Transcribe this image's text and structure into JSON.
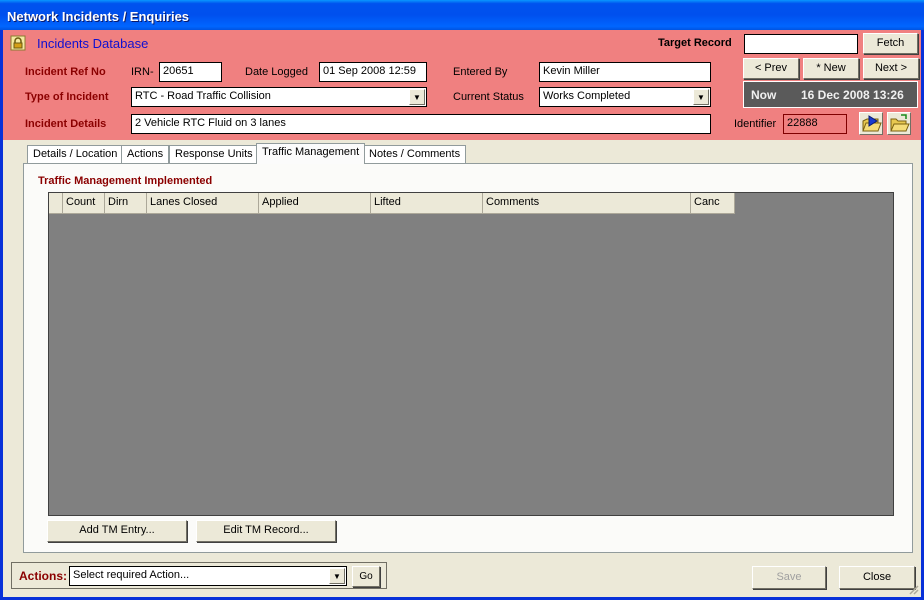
{
  "window": {
    "title": "Network Incidents / Enquiries"
  },
  "header": {
    "db_title": "Incidents Database",
    "target_record_label": "Target Record",
    "target_record_value": "",
    "fetch_label": "Fetch",
    "prev_label": "< Prev",
    "new_label": "* New",
    "next_label": "Next >",
    "now_label": "Now",
    "now_value": "16 Dec 2008 13:26",
    "incident_ref_label": "Incident Ref No",
    "irn_prefix": "IRN-",
    "irn_value": "20651",
    "date_logged_label": "Date Logged",
    "date_logged_value": "01 Sep 2008 12:59",
    "entered_by_label": "Entered By",
    "entered_by_value": "Kevin Miller",
    "type_label": "Type of Incident",
    "type_value": "RTC - Road Traffic Collision",
    "status_label": "Current Status",
    "status_value": "Works Completed",
    "details_label": "Incident Details",
    "details_value": "2 Vehicle RTC Fluid on 3 lanes",
    "identifier_label": "Identifier",
    "identifier_value": "22888",
    "accent_color": "#f08080"
  },
  "tabs": [
    {
      "label": "Details / Location"
    },
    {
      "label": "Actions"
    },
    {
      "label": "Response Units"
    },
    {
      "label": "Traffic Management"
    },
    {
      "label": "Notes / Comments"
    }
  ],
  "active_tab": "Traffic Management",
  "panel": {
    "section_title": "Traffic Management Implemented",
    "columns": [
      "",
      "Count",
      "Dirn",
      "Lanes Closed",
      "Applied",
      "Lifted",
      "Comments",
      "Canc"
    ],
    "rows": [],
    "add_button": "Add TM Entry...",
    "edit_button": "Edit TM Record..."
  },
  "footer": {
    "actions_label": "Actions:",
    "actions_value": "Select required Action...",
    "go_label": "Go",
    "save_label": "Save",
    "close_label": "Close"
  }
}
